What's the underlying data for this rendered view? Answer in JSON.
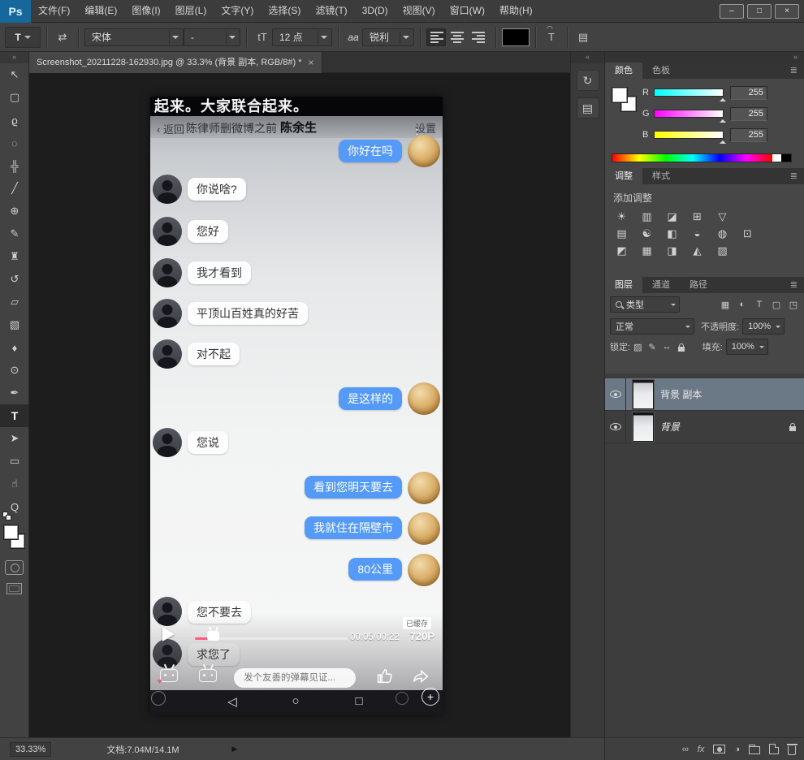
{
  "titlebar": {
    "logo": "Ps",
    "menus": [
      "文件(F)",
      "编辑(E)",
      "图像(I)",
      "图层(L)",
      "文字(Y)",
      "选择(S)",
      "滤镜(T)",
      "3D(D)",
      "视图(V)",
      "窗口(W)",
      "帮助(H)"
    ],
    "window_controls": {
      "minimize": "–",
      "maximize": "□",
      "close": "×"
    }
  },
  "options_bar": {
    "tool": "T",
    "orientation": "⇄",
    "font_family": "宋体",
    "font_style": "-",
    "size_icon": "tT",
    "font_size": "12 点",
    "aa": "aa",
    "anti_alias": "锐利",
    "warp": "T",
    "panels": "▤",
    "color_hex": "#000000"
  },
  "tools": [
    {
      "name": "move",
      "glyph": "↖"
    },
    {
      "name": "rectangular-marquee",
      "glyph": "▢"
    },
    {
      "name": "lasso",
      "glyph": "ϱ"
    },
    {
      "name": "quick-selection",
      "glyph": "◌"
    },
    {
      "name": "crop",
      "glyph": "╬"
    },
    {
      "name": "eyedropper",
      "glyph": "╱"
    },
    {
      "name": "spot-healing",
      "glyph": "⊕"
    },
    {
      "name": "brush",
      "glyph": "✎"
    },
    {
      "name": "clone-stamp",
      "glyph": "♜"
    },
    {
      "name": "history-brush",
      "glyph": "↺"
    },
    {
      "name": "eraser",
      "glyph": "▱"
    },
    {
      "name": "gradient",
      "glyph": "▧"
    },
    {
      "name": "blur",
      "glyph": "♦"
    },
    {
      "name": "dodge",
      "glyph": "⊙"
    },
    {
      "name": "pen",
      "glyph": "✒"
    },
    {
      "name": "horizontal-type",
      "glyph": "T",
      "selected": true
    },
    {
      "name": "path-selection",
      "glyph": "➤"
    },
    {
      "name": "rectangle",
      "glyph": "▭"
    },
    {
      "name": "hand",
      "glyph": "☝"
    },
    {
      "name": "zoom",
      "glyph": "Q"
    }
  ],
  "tab": {
    "title": "Screenshot_20211228-162930.jpg @ 33.3% (背景 副本, RGB/8#) *",
    "close": "×"
  },
  "phone": {
    "subtitle": "起来。大家联合起来。",
    "back": "‹ 返回",
    "chat_title": "陈律师删微博之前",
    "video_name": "陈余生",
    "settings": "设置",
    "menu_dots": "⋮",
    "messages": [
      {
        "side": "right",
        "text": "你好在吗"
      },
      {
        "side": "left",
        "text": "你说啥?"
      },
      {
        "side": "left",
        "text": "您好"
      },
      {
        "side": "left",
        "text": "我才看到"
      },
      {
        "side": "left",
        "text": "平顶山百姓真的好苦"
      },
      {
        "side": "left",
        "text": "对不起"
      },
      {
        "side": "right",
        "text": "是这样的"
      },
      {
        "side": "left",
        "text": "您说"
      },
      {
        "side": "right",
        "text": "看到您明天要去"
      },
      {
        "side": "right",
        "text": "我就住在隔壁市"
      },
      {
        "side": "right",
        "text": "80公里"
      },
      {
        "side": "left",
        "text": "您不要去"
      },
      {
        "side": "left",
        "text": "求您了"
      }
    ],
    "time": "00:05/00:22",
    "cached": "已缓存",
    "quality": "720P",
    "danmaku_placeholder": "发个友善的弹幕见证...",
    "nav": {
      "back": "◁",
      "home": "○",
      "recent": "□"
    },
    "plus": "+",
    "colors": {
      "bubble_blue": "#549af6",
      "progress_pink": "#ff5b7e"
    }
  },
  "strip": {
    "collapse": "«",
    "icons": [
      {
        "name": "history-panel",
        "glyph": "↻"
      },
      {
        "name": "properties-panel",
        "glyph": "▤"
      }
    ]
  },
  "dock": {
    "collapse": "»"
  },
  "panels": {
    "color": {
      "tabs": [
        "颜色",
        "色板"
      ],
      "menu": "≣",
      "channels": [
        {
          "label": "R",
          "value": "255"
        },
        {
          "label": "G",
          "value": "255"
        },
        {
          "label": "B",
          "value": "255"
        }
      ]
    },
    "adjustments": {
      "tabs": [
        "调整",
        "样式"
      ],
      "menu": "≣",
      "add_label": "添加调整",
      "icons": [
        {
          "name": "brightness-contrast",
          "glyph": "☀"
        },
        {
          "name": "levels",
          "glyph": "▥"
        },
        {
          "name": "curves",
          "glyph": "◪"
        },
        {
          "name": "exposure",
          "glyph": "⊞"
        },
        {
          "name": "vibrance",
          "glyph": "▽"
        },
        {
          "name": "hue-saturation",
          "glyph": "▤"
        },
        {
          "name": "color-balance",
          "glyph": "☯"
        },
        {
          "name": "black-white",
          "glyph": "◧"
        },
        {
          "name": "photo-filter",
          "glyph": "◒"
        },
        {
          "name": "channel-mixer",
          "glyph": "◍"
        },
        {
          "name": "color-lookup",
          "glyph": "⊡"
        },
        {
          "name": "invert",
          "glyph": "◩"
        },
        {
          "name": "posterize",
          "glyph": "▦"
        },
        {
          "name": "threshold",
          "glyph": "◨"
        },
        {
          "name": "selective-color",
          "glyph": "◭"
        },
        {
          "name": "gradient-map",
          "glyph": "▨"
        }
      ]
    },
    "layers": {
      "tabs": [
        "图层",
        "通道",
        "路径"
      ],
      "menu": "≣",
      "filter_label": "类型",
      "filter_icons": [
        {
          "name": "filter-pixel",
          "glyph": "▦"
        },
        {
          "name": "filter-adjustment",
          "glyph": "◐"
        },
        {
          "name": "filter-type",
          "glyph": "T"
        },
        {
          "name": "filter-shape",
          "glyph": "▢"
        },
        {
          "name": "filter-smart",
          "glyph": "◳"
        }
      ],
      "blend_mode": "正常",
      "opacity_label": "不透明度:",
      "opacity": "100%",
      "lock_label": "锁定:",
      "lock_icons": [
        {
          "name": "lock-transparency",
          "glyph": "▨"
        },
        {
          "name": "lock-image",
          "glyph": "✎"
        },
        {
          "name": "lock-position",
          "glyph": "↔"
        }
      ],
      "fill_label": "填充:",
      "fill": "100%",
      "rows": [
        {
          "name": "背景 副本",
          "selected": true
        },
        {
          "name": "背景",
          "locked": true
        }
      ],
      "bottom": {
        "link": "∞",
        "fx": "fx",
        "adjustment": "◑"
      }
    }
  },
  "statusbar": {
    "zoom": "33.33%",
    "doc_info": "文档:7.04M/14.1M",
    "expand": "▶"
  }
}
